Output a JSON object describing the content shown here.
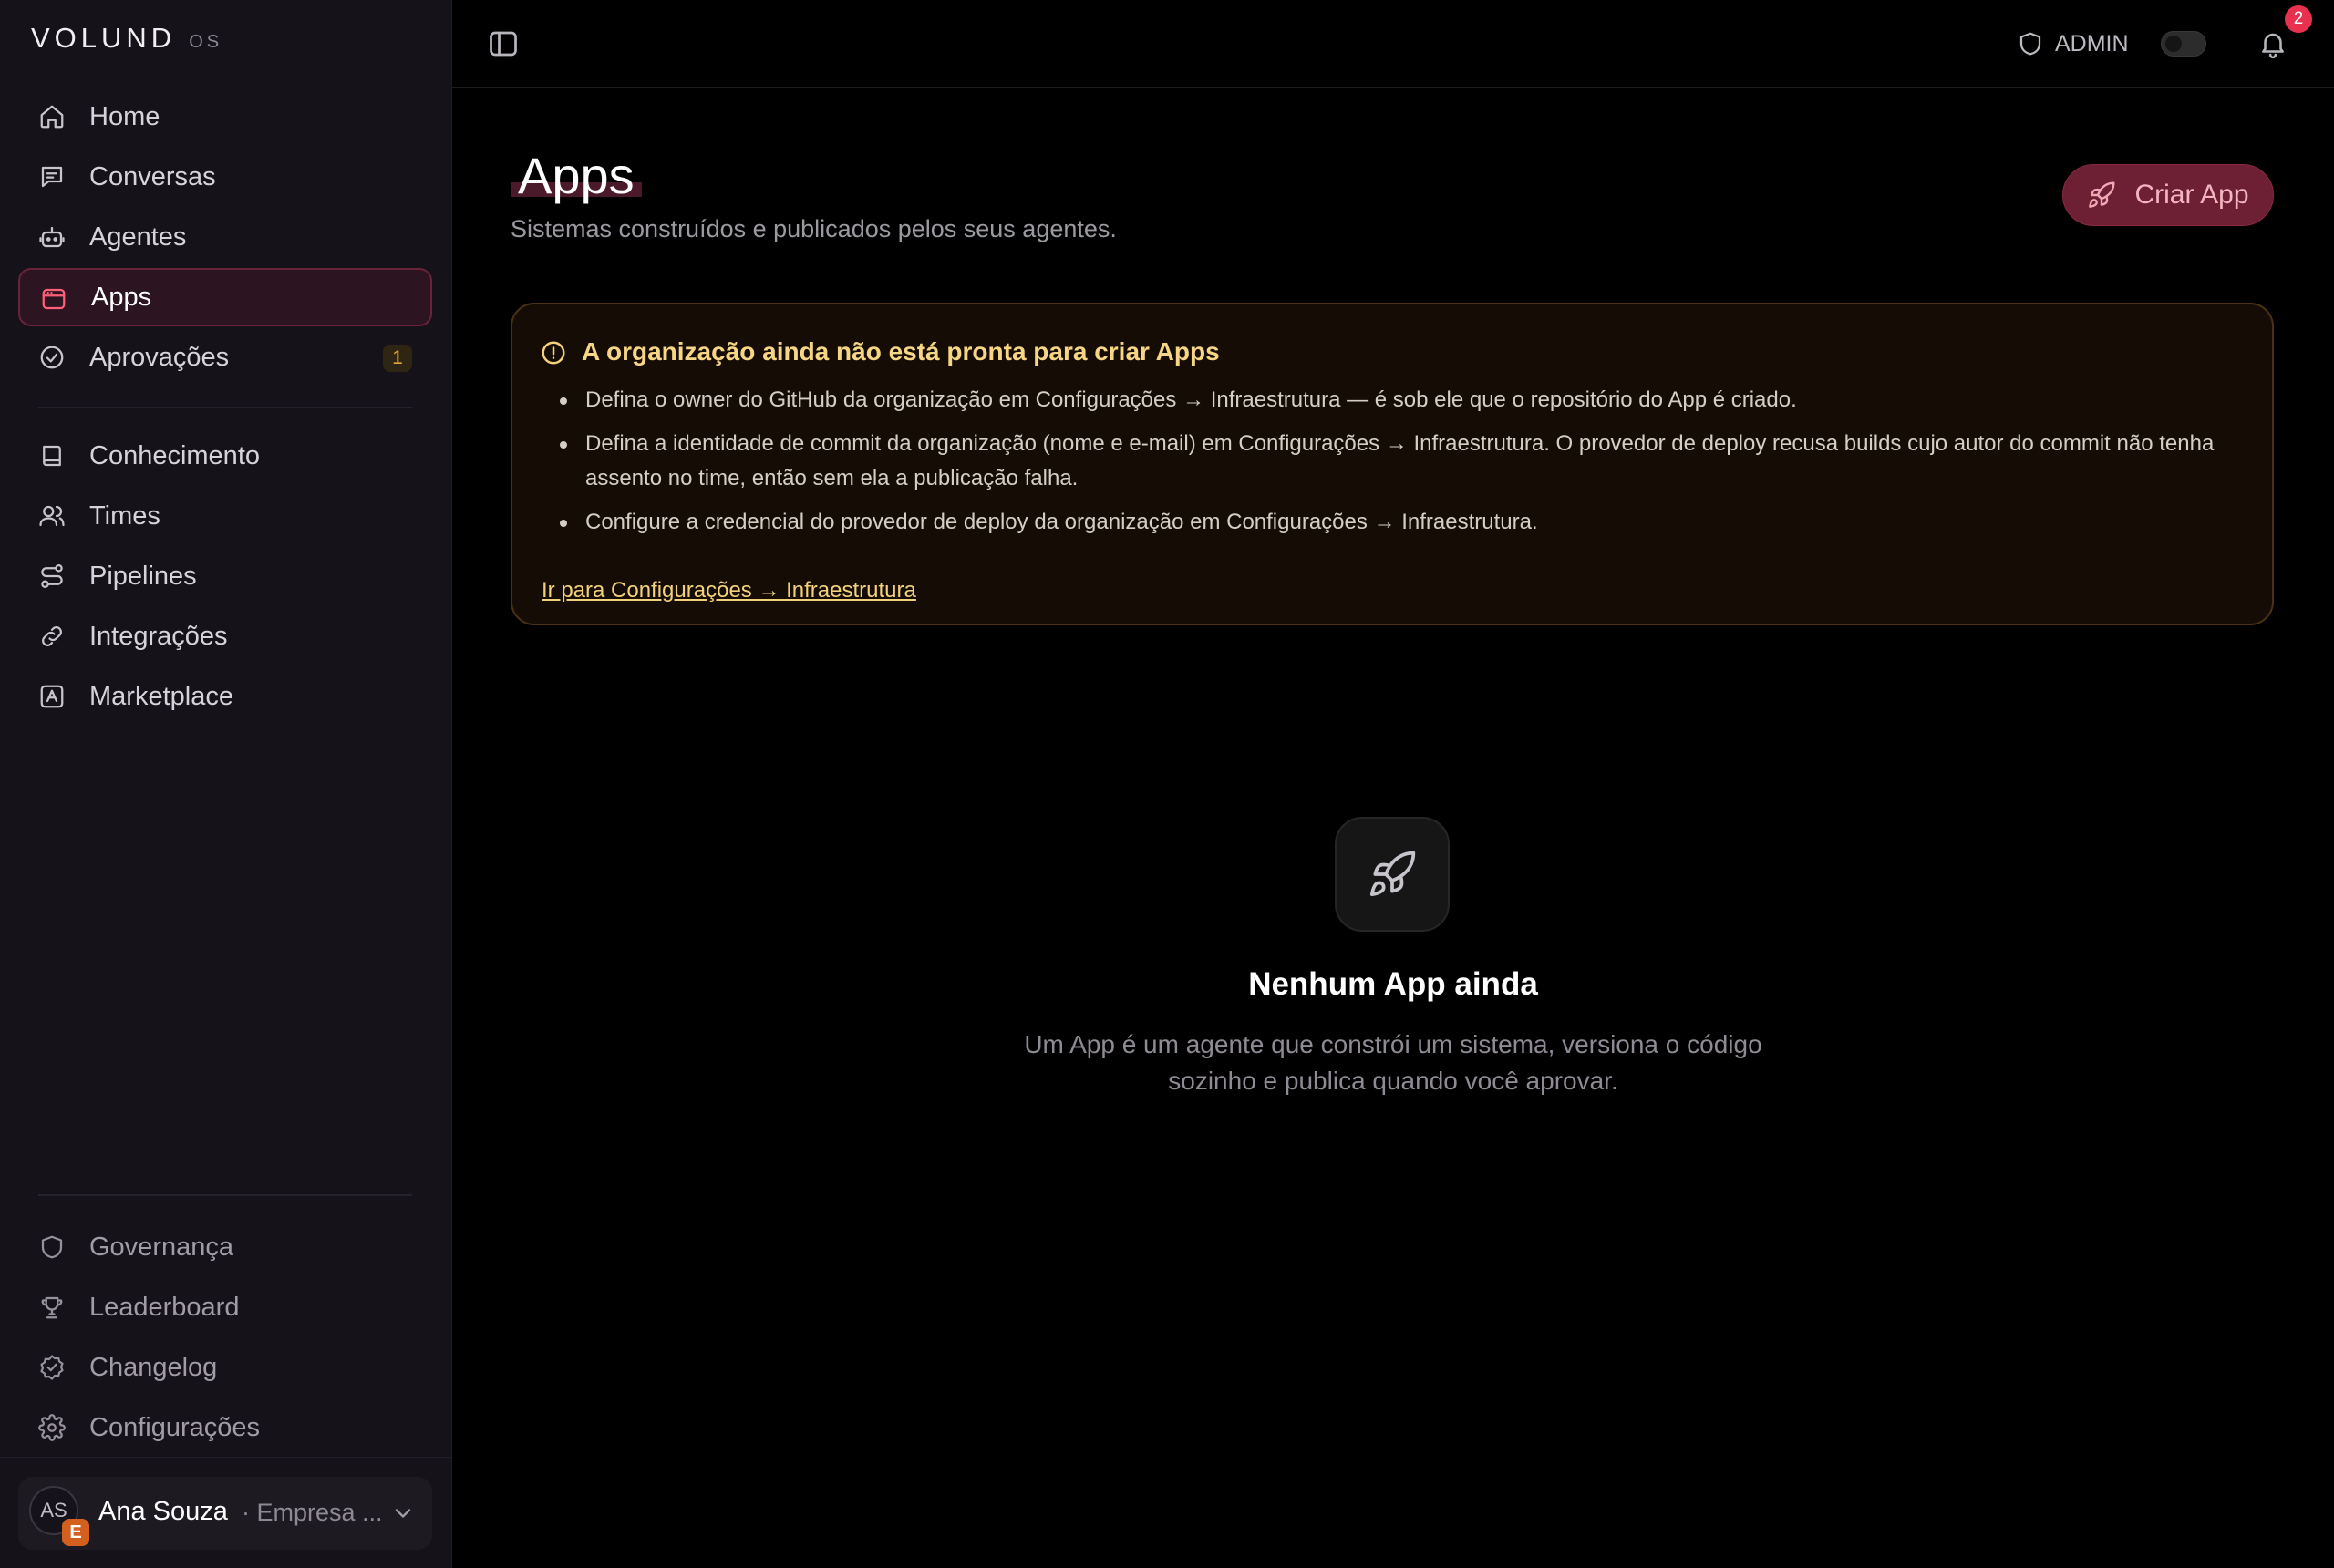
{
  "brand": {
    "name": "VOLUND",
    "suffix": "OS"
  },
  "sidebar": {
    "items": [
      {
        "label": "Home",
        "icon": "home-icon"
      },
      {
        "label": "Conversas",
        "icon": "chat-icon"
      },
      {
        "label": "Agentes",
        "icon": "bot-icon"
      },
      {
        "label": "Apps",
        "icon": "app-window-icon",
        "active": true
      },
      {
        "label": "Aprovações",
        "icon": "check-circle-icon",
        "badge": "1"
      },
      {
        "label": "Conhecimento",
        "icon": "book-icon"
      },
      {
        "label": "Times",
        "icon": "users-icon"
      },
      {
        "label": "Pipelines",
        "icon": "route-icon"
      },
      {
        "label": "Integrações",
        "icon": "link-icon"
      },
      {
        "label": "Marketplace",
        "icon": "store-icon"
      }
    ],
    "footer_items": [
      {
        "label": "Governança",
        "icon": "shield-icon"
      },
      {
        "label": "Leaderboard",
        "icon": "trophy-icon"
      },
      {
        "label": "Changelog",
        "icon": "badge-check-icon"
      },
      {
        "label": "Configurações",
        "icon": "gear-icon"
      }
    ],
    "user": {
      "initials": "AS",
      "badge": "E",
      "name": "Ana Souza",
      "org": "· Empresa ..."
    }
  },
  "topbar": {
    "role": "ADMIN",
    "notifications": "2"
  },
  "main": {
    "title": "Apps",
    "subtitle": "Sistemas construídos e publicados pelos seus agentes.",
    "create_label": "Criar App",
    "warning": {
      "title": "A organização ainda não está pronta para criar Apps",
      "items": [
        "Defina o owner do GitHub da organização em Configurações → Infraestrutura — é sob ele que o repositório do App é criado.",
        "Defina a identidade de commit da organização (nome e e-mail) em Configurações → Infraestrutura. O provedor de deploy recusa builds cujo autor do commit não tenha assento no time, então sem ela a publicação falha.",
        "Configure a credencial do provedor de deploy da organização em Configurações → Infraestrutura."
      ],
      "link": "Ir para Configurações → Infraestrutura"
    },
    "empty": {
      "title": "Nenhum App ainda",
      "text": "Um App é um agente que constrói um sistema, versiona o código sozinho e publica quando você aprovar."
    }
  },
  "colors": {
    "accent": "#ff5e78",
    "warning": "#f3d07a",
    "sidebar_bg": "#15121a"
  }
}
